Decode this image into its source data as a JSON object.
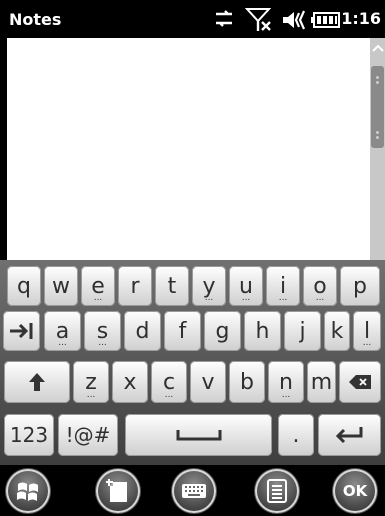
{
  "app_title": "Notes",
  "clock": "1:16",
  "status_icons": [
    "sync-icon",
    "no-signal-icon",
    "volume-icon",
    "battery-icon"
  ],
  "scrollbar": {
    "up": "▲",
    "down": "▼"
  },
  "keyboard": {
    "row1": [
      "q",
      "w",
      "e",
      "r",
      "t",
      "y",
      "u",
      "i",
      "o",
      "p"
    ],
    "row2": [
      "a",
      "s",
      "d",
      "f",
      "g",
      "h",
      "j",
      "k",
      "l"
    ],
    "row3": [
      "z",
      "x",
      "c",
      "v",
      "b",
      "n",
      "m"
    ],
    "row4": {
      "numbers": "123",
      "symbols": "!@#",
      "period": "."
    },
    "dots": "..."
  },
  "taskbar": {
    "start_icon": "windows-flag-icon",
    "new_note_icon": "new-note-icon",
    "keyboard_icon": "keyboard-icon",
    "menu_icon": "menu-icon",
    "ok_label": "OK"
  }
}
